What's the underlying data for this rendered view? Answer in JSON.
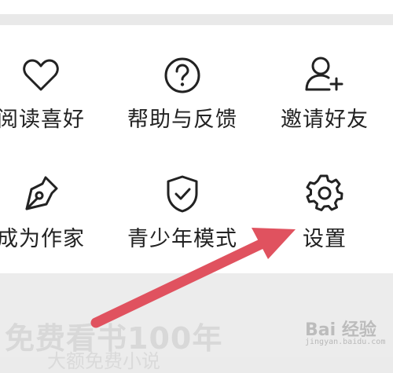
{
  "grid": {
    "row1": [
      {
        "label": "阅读喜好",
        "icon": "heart-icon"
      },
      {
        "label": "帮助与反馈",
        "icon": "help-circle-icon"
      },
      {
        "label": "邀请好友",
        "icon": "add-user-icon"
      }
    ],
    "row2": [
      {
        "label": "成为作家",
        "icon": "pen-nib-icon"
      },
      {
        "label": "青少年模式",
        "icon": "shield-check-icon"
      },
      {
        "label": "设置",
        "icon": "gear-icon"
      }
    ]
  },
  "promo": {
    "title": "免费看书100年",
    "subtitle": "大额免费小说"
  },
  "watermark": {
    "main": "Bai 经验",
    "sub": "jingyan.baidu.com"
  },
  "colors": {
    "annotation_arrow": "#e0525f",
    "text": "#222222",
    "background": "#ebebeb"
  }
}
